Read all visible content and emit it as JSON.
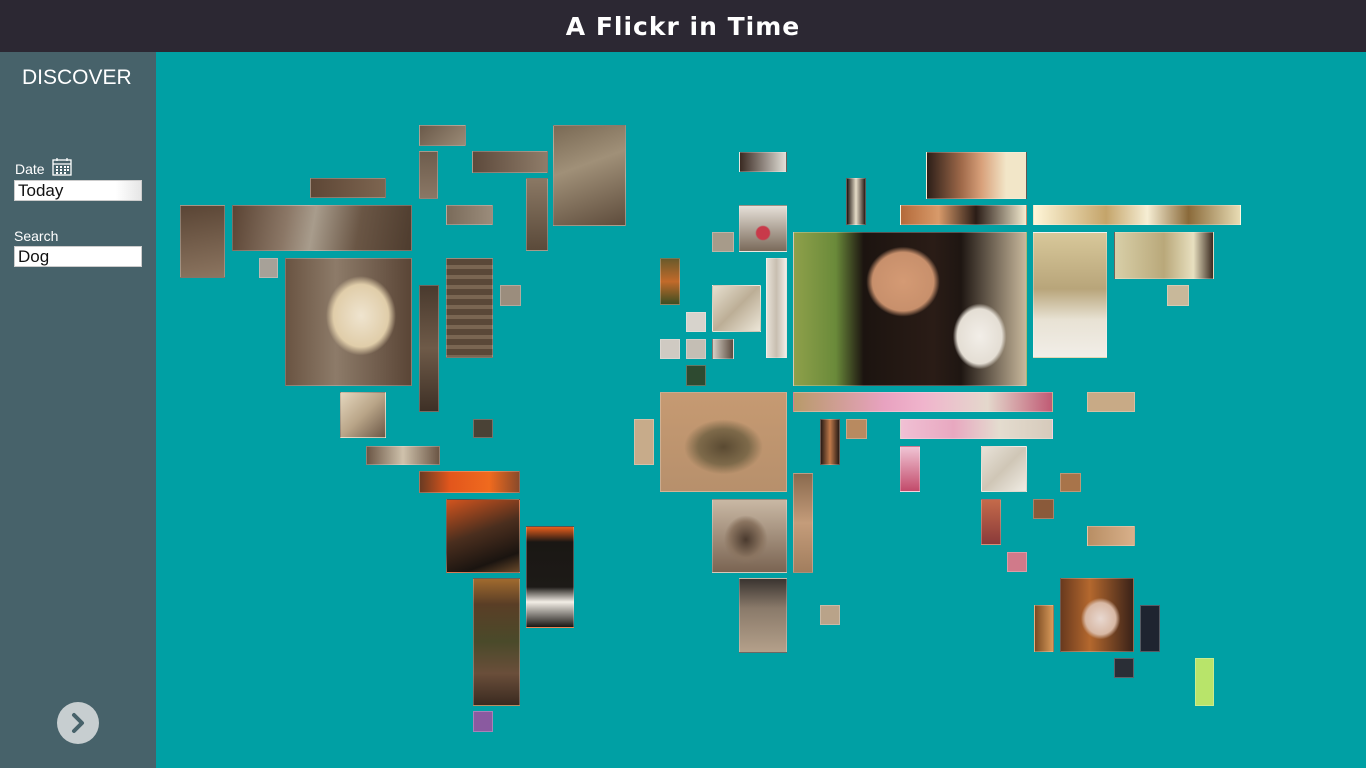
{
  "header": {
    "title": "A Flickr in Time"
  },
  "sidebar": {
    "heading": "DISCOVER",
    "date_label": "Date",
    "date_value": "Today",
    "search_label": "Search",
    "search_value": "Dog",
    "calendar_icon": "calendar-icon",
    "next_icon": "chevron-right-icon"
  },
  "colors": {
    "background": "#00a0a4",
    "topbar": "#2c2833",
    "sidebar": "#47626a"
  }
}
